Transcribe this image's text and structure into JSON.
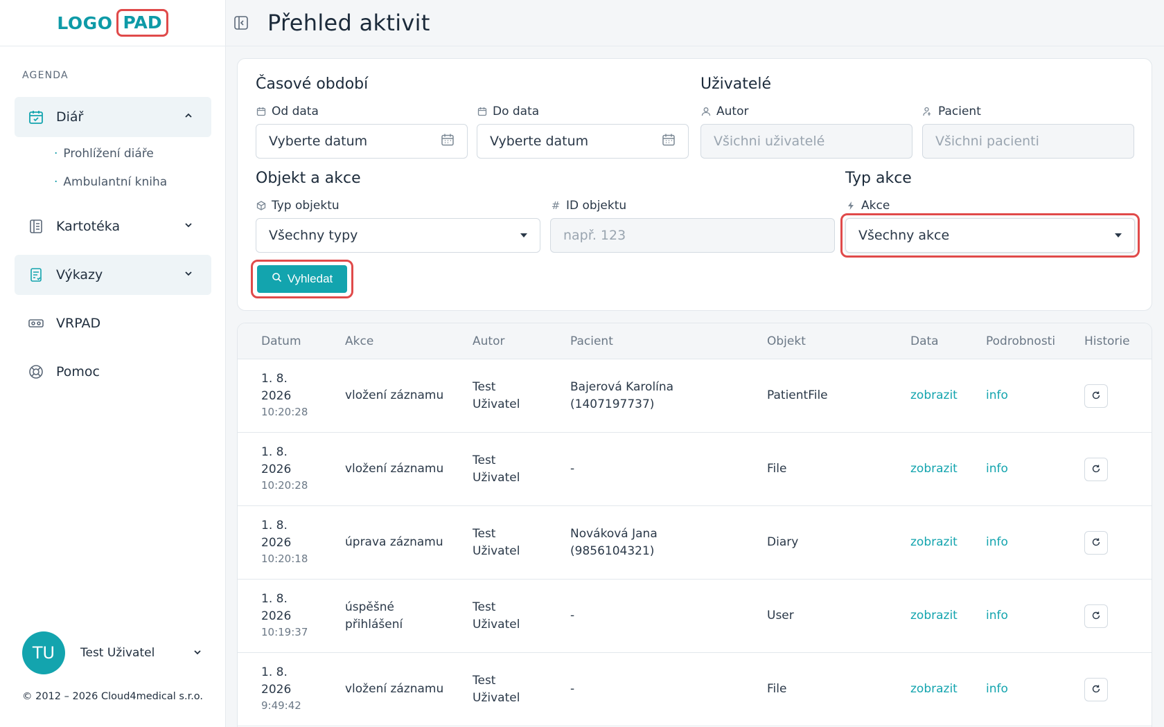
{
  "logo": {
    "part1": "LOGO",
    "part2": "PAD"
  },
  "sidebar": {
    "section": "AGENDA",
    "items": [
      {
        "label": "Diář",
        "icon": "calendar-check-icon",
        "subitems": [
          "Prohlížení diáře",
          "Ambulantní kniha"
        ]
      },
      {
        "label": "Kartotéka",
        "icon": "book-icon"
      },
      {
        "label": "Výkazy",
        "icon": "report-icon"
      },
      {
        "label": "VRPAD",
        "icon": "vr-headset-icon"
      },
      {
        "label": "Pomoc",
        "icon": "lifebuoy-icon"
      }
    ],
    "user": {
      "initials": "TU",
      "name": "Test Uživatel"
    },
    "copyright": "© 2012 – 2026 Cloud4medical s.r.o."
  },
  "header": {
    "title": "Přehled aktivit"
  },
  "filters": {
    "period": {
      "title": "Časové období",
      "from_label": "Od data",
      "from_value": "Vyberte datum",
      "to_label": "Do data",
      "to_value": "Vyberte datum"
    },
    "users": {
      "title": "Uživatelé",
      "author_label": "Autor",
      "author_placeholder": "Všichni uživatelé",
      "patient_label": "Pacient",
      "patient_placeholder": "Všichni pacienti"
    },
    "object": {
      "title": "Objekt a akce",
      "type_label": "Typ objektu",
      "type_value": "Všechny typy",
      "id_label": "ID objektu",
      "id_placeholder": "např. 123"
    },
    "action": {
      "title": "Typ akce",
      "action_label": "Akce",
      "action_value": "Všechny akce"
    },
    "search_label": "Vyhledat"
  },
  "table": {
    "headers": [
      "Datum",
      "Akce",
      "Autor",
      "Pacient",
      "Objekt",
      "Data",
      "Podrobnosti",
      "Historie"
    ],
    "rows": [
      {
        "date1": "1. 8.",
        "date2": "2026",
        "time": "10:20:28",
        "action1": "vložení záznamu",
        "action2": "",
        "author1": "Test",
        "author2": "Uživatel",
        "patient1": "Bajerová Karolína",
        "patient2": "(1407197737)",
        "object": "PatientFile",
        "data": "zobrazit",
        "details": "info"
      },
      {
        "date1": "1. 8.",
        "date2": "2026",
        "time": "10:20:28",
        "action1": "vložení záznamu",
        "action2": "",
        "author1": "Test",
        "author2": "Uživatel",
        "patient1": "-",
        "patient2": "",
        "object": "File",
        "data": "zobrazit",
        "details": "info"
      },
      {
        "date1": "1. 8.",
        "date2": "2026",
        "time": "10:20:18",
        "action1": "úprava záznamu",
        "action2": "",
        "author1": "Test",
        "author2": "Uživatel",
        "patient1": "Nováková Jana",
        "patient2": "(9856104321)",
        "object": "Diary",
        "data": "zobrazit",
        "details": "info"
      },
      {
        "date1": "1. 8.",
        "date2": "2026",
        "time": "10:19:37",
        "action1": "úspěšné",
        "action2": "přihlášení",
        "author1": "Test",
        "author2": "Uživatel",
        "patient1": "-",
        "patient2": "",
        "object": "User",
        "data": "zobrazit",
        "details": "info"
      },
      {
        "date1": "1. 8.",
        "date2": "2026",
        "time": "9:49:42",
        "action1": "vložení záznamu",
        "action2": "",
        "author1": "Test",
        "author2": "Uživatel",
        "patient1": "-",
        "patient2": "",
        "object": "File",
        "data": "zobrazit",
        "details": "info"
      }
    ]
  },
  "colors": {
    "accent": "#13a4ae",
    "highlight": "#e04a4a"
  }
}
